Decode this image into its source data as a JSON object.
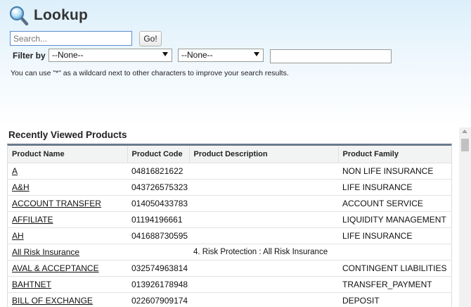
{
  "header": {
    "title": "Lookup",
    "icon": "magnifier-icon"
  },
  "search": {
    "placeholder": "Search...",
    "value": "",
    "go_label": "Go!"
  },
  "filter": {
    "label": "Filter by",
    "select1": "--None--",
    "select2": "--None--",
    "value": ""
  },
  "help_text": "You can use \"*\" as a wildcard next to other characters to improve your search results.",
  "section_title": "Recently Viewed Products",
  "table": {
    "columns": [
      "Product Name",
      "Product Code",
      "Product Description",
      "Product Family"
    ],
    "rows": [
      {
        "name": "A",
        "code": "04816821622",
        "description": "",
        "family": "NON LIFE INSURANCE"
      },
      {
        "name": "A&H",
        "code": "043726575323",
        "description": "",
        "family": "LIFE INSURANCE"
      },
      {
        "name": "ACCOUNT TRANSFER",
        "code": "014050433783",
        "description": "",
        "family": "ACCOUNT SERVICE"
      },
      {
        "name": "AFFILIATE",
        "code": "01194196661",
        "description": "",
        "family": "LIQUIDITY MANAGEMENT"
      },
      {
        "name": "AH",
        "code": "041688730595",
        "description": "",
        "family": "LIFE INSURANCE"
      },
      {
        "name": "All Risk Insurance",
        "code": "",
        "description": "4. Risk Protection : All Risk Insurance",
        "family": ""
      },
      {
        "name": "AVAL & ACCEPTANCE",
        "code": "032574963814",
        "description": "",
        "family": "CONTINGENT LIABILITIES"
      },
      {
        "name": "BAHTNET",
        "code": "013926178948",
        "description": "",
        "family": "TRANSFER_PAYMENT"
      },
      {
        "name": "BILL OF EXCHANGE",
        "code": "022607909174",
        "description": "",
        "family": "DEPOSIT"
      }
    ]
  }
}
